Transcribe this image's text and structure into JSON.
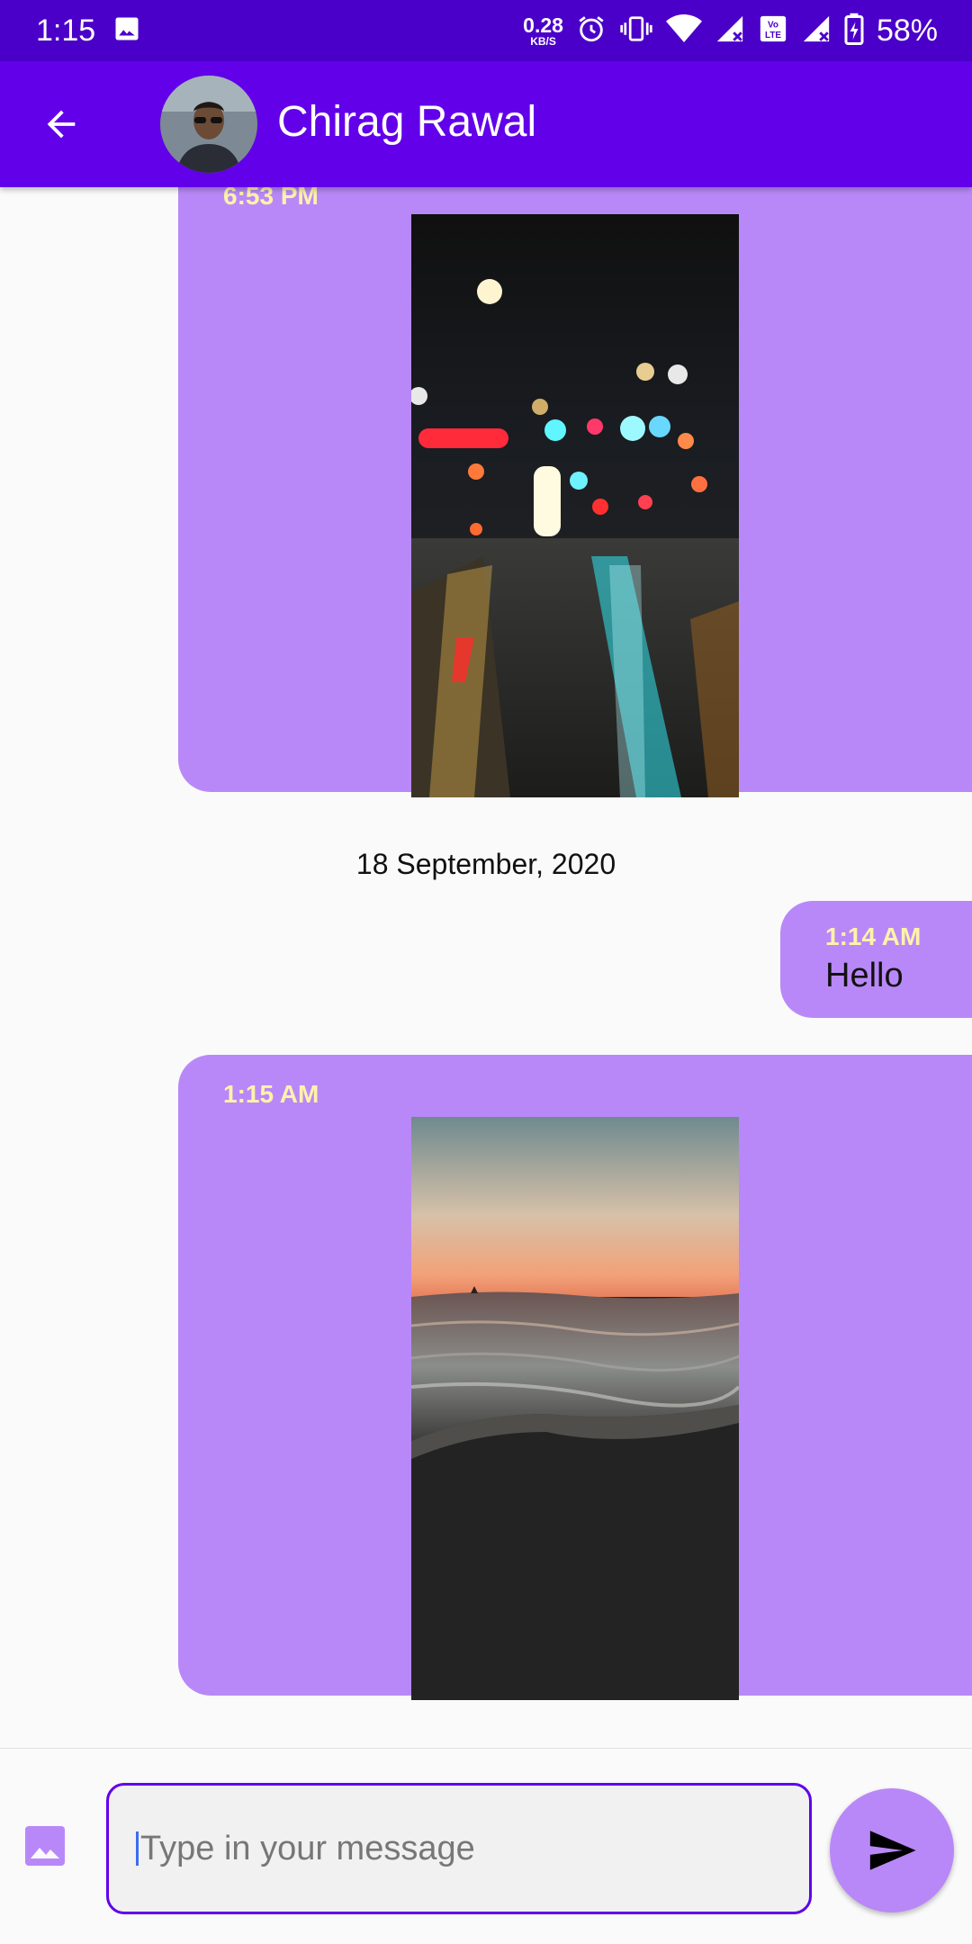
{
  "status_bar": {
    "time": "1:15",
    "net_speed_value": "0.28",
    "net_speed_unit": "KB/S",
    "battery_percent": "58%",
    "icons": [
      "gallery-icon",
      "alarm-icon",
      "vibrate-icon",
      "wifi-icon",
      "signal-icon",
      "volte-icon",
      "signal-icon",
      "battery-charging-icon"
    ]
  },
  "app_bar": {
    "contact_name": "Chirag Rawal",
    "back_icon": "arrow-back-icon",
    "color": "#6200ea"
  },
  "messages": [
    {
      "type": "image",
      "time": "6:53 PM",
      "image": "night-street-bokeh-photo"
    },
    {
      "type": "date_separator",
      "text": "18 September, 2020"
    },
    {
      "type": "text",
      "time": "1:14 AM",
      "text": "Hello"
    },
    {
      "type": "image",
      "time": "1:15 AM",
      "image": "ocean-sunset-wave-photo"
    }
  ],
  "composer": {
    "placeholder": "Type in your message",
    "gallery_icon": "image-icon",
    "send_icon": "send-icon"
  },
  "colors": {
    "status_bar": "#4b00c9",
    "bubble": "#b988f8",
    "time_text": "#fff3a8",
    "accent": "#6200ea"
  }
}
